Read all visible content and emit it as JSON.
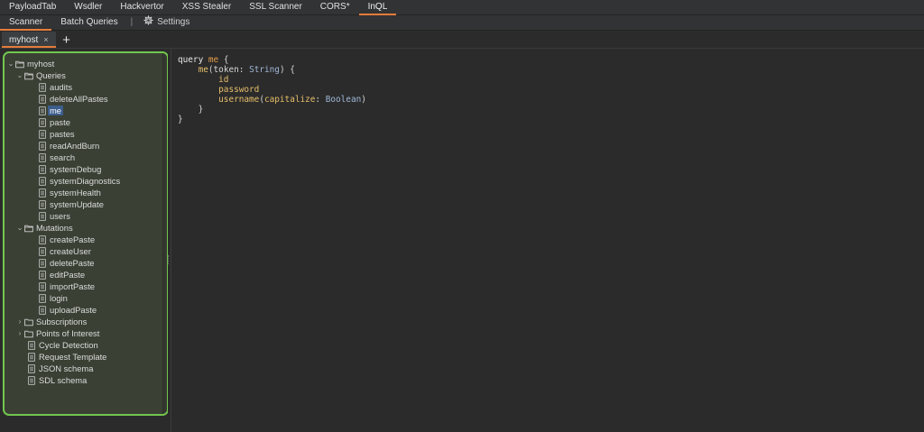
{
  "top_tabs": [
    "PayloadTab",
    "Wsdler",
    "Hackvertor",
    "XSS Stealer",
    "SSL Scanner",
    "CORS*",
    "InQL"
  ],
  "top_active": "InQL",
  "sub_tabs": [
    "Scanner",
    "Batch Queries"
  ],
  "sub_separator": "|",
  "settings_label": "Settings",
  "host_tab": {
    "label": "myhost",
    "close": "×"
  },
  "add_tab": "+",
  "tree": {
    "root": "myhost",
    "queries_label": "Queries",
    "queries": [
      "audits",
      "deleteAllPastes",
      "me",
      "paste",
      "pastes",
      "readAndBurn",
      "search",
      "systemDebug",
      "systemDiagnostics",
      "systemHealth",
      "systemUpdate",
      "users"
    ],
    "selected": "me",
    "mutations_label": "Mutations",
    "mutations": [
      "createPaste",
      "createUser",
      "deletePaste",
      "editPaste",
      "importPaste",
      "login",
      "uploadPaste"
    ],
    "subscriptions_label": "Subscriptions",
    "points_label": "Points of Interest",
    "extras": [
      "Cycle Detection",
      "Request Template",
      "JSON schema",
      "SDL schema"
    ]
  },
  "code": {
    "l1_kw": "query",
    "l1_name": "me",
    "l1_brace": "{",
    "l2_field": "me",
    "l2_open": "(",
    "l2_arg": "token",
    "l2_colon": ": ",
    "l2_type": "String",
    "l2_close": ") {",
    "l3_field": "id",
    "l4_field": "password",
    "l5_field": "username",
    "l5_open": "(",
    "l5_arg": "capitalize",
    "l5_colon": ": ",
    "l5_type": "Boolean",
    "l5_close": ")",
    "l6_close": "}",
    "l7_close": "}"
  },
  "colors": {
    "accent": "#e57c3a",
    "tree_border": "#72c64f",
    "tree_bg": "#3a4034",
    "selection": "#3d5d8c"
  }
}
